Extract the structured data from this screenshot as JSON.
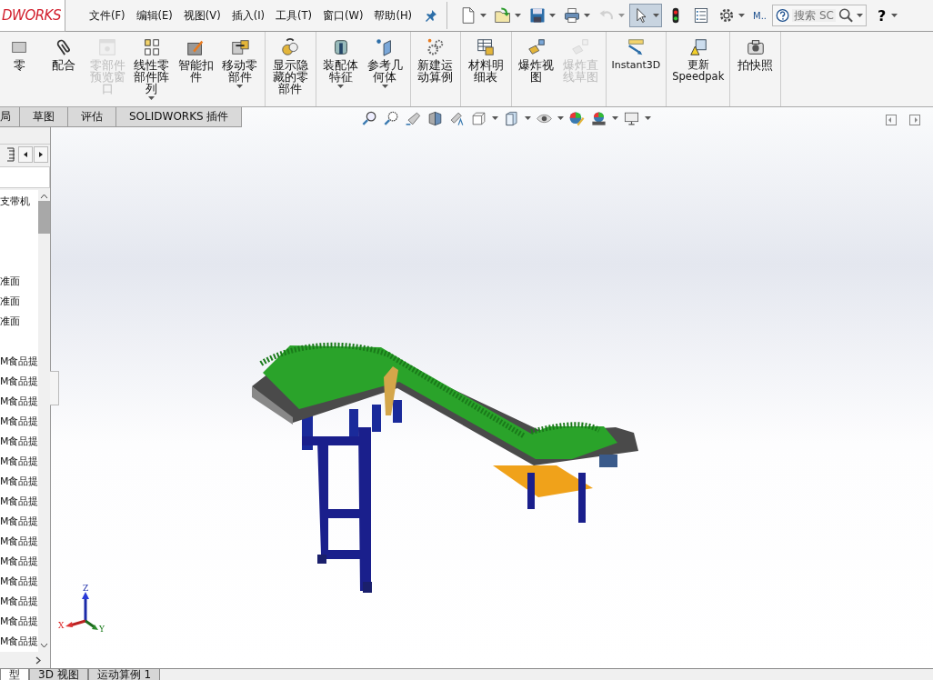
{
  "title_bar": {
    "logo": "DWORKS",
    "menu": [
      "文件(F)",
      "编辑(E)",
      "视图(V)",
      "插入(I)",
      "工具(T)",
      "窗口(W)",
      "帮助(H)"
    ],
    "quick_access": [
      {
        "kind": "new",
        "dropdown": true,
        "disabled": false,
        "selected": false
      },
      {
        "kind": "open",
        "dropdown": true,
        "disabled": false,
        "selected": false
      },
      {
        "kind": "save",
        "dropdown": true,
        "disabled": false,
        "selected": false
      },
      {
        "kind": "print",
        "dropdown": true,
        "disabled": false,
        "selected": false
      },
      {
        "kind": "undo",
        "dropdown": true,
        "disabled": true,
        "selected": false
      },
      {
        "kind": "select",
        "dropdown": true,
        "disabled": false,
        "selected": true
      },
      {
        "kind": "rebuild",
        "dropdown": false,
        "disabled": false,
        "selected": false
      },
      {
        "kind": "properties",
        "dropdown": false,
        "disabled": false,
        "selected": false
      },
      {
        "kind": "options",
        "dropdown": true,
        "disabled": false,
        "selected": false
      }
    ],
    "user": "M..",
    "search": {
      "placeholder": "搜索 SC"
    },
    "help": "?"
  },
  "ribbon": {
    "groups": [
      {
        "items": [
          {
            "kind": "part",
            "label": "零",
            "disabled": false,
            "dropdown": false
          },
          {
            "kind": "mate",
            "label": "配合",
            "disabled": false,
            "dropdown": false
          },
          {
            "kind": "preview",
            "label": "零部件预览窗口",
            "disabled": true,
            "dropdown": false
          },
          {
            "kind": "pattern",
            "label": "线性零部件阵列",
            "disabled": false,
            "dropdown": true
          },
          {
            "kind": "fastener",
            "label": "智能扣件",
            "disabled": false,
            "dropdown": false
          },
          {
            "kind": "move",
            "label": "移动零部件",
            "disabled": false,
            "dropdown": true
          }
        ]
      },
      {
        "items": [
          {
            "kind": "show-hidden",
            "label": "显示隐藏的零部件",
            "disabled": false,
            "dropdown": false
          }
        ]
      },
      {
        "items": [
          {
            "kind": "asm-feature",
            "label": "装配体特征",
            "disabled": false,
            "dropdown": true
          },
          {
            "kind": "ref-geometry",
            "label": "参考几何体",
            "disabled": false,
            "dropdown": true
          }
        ]
      },
      {
        "items": [
          {
            "kind": "motion",
            "label": "新建运动算例",
            "disabled": false,
            "dropdown": false
          }
        ]
      },
      {
        "items": [
          {
            "kind": "bom",
            "label": "材料明细表",
            "disabled": false,
            "dropdown": false
          }
        ]
      },
      {
        "items": [
          {
            "kind": "explode",
            "label": "爆炸视图",
            "disabled": false,
            "dropdown": false
          },
          {
            "kind": "explode-line",
            "label": "爆炸直线草图",
            "disabled": true,
            "dropdown": false
          }
        ]
      },
      {
        "items": [
          {
            "kind": "instant3d",
            "label": "Instant3D",
            "disabled": false,
            "dropdown": false
          }
        ]
      },
      {
        "items": [
          {
            "kind": "speedpak",
            "label": "更新 Speedpak",
            "disabled": false,
            "dropdown": false
          }
        ]
      },
      {
        "items": [
          {
            "kind": "snapshot",
            "label": "拍快照",
            "disabled": false,
            "dropdown": false
          }
        ]
      }
    ]
  },
  "tabs": [
    {
      "label": "局",
      "selected": false
    },
    {
      "label": "草图",
      "selected": false
    },
    {
      "label": "评估",
      "selected": false
    },
    {
      "label": "SOLIDWORKS 插件",
      "selected": false
    }
  ],
  "view_toolbar": [
    {
      "kind": "zoom-fit",
      "dropdown": false
    },
    {
      "kind": "zoom-area",
      "dropdown": false
    },
    {
      "kind": "previous-view",
      "dropdown": false
    },
    {
      "kind": "section",
      "dropdown": false
    },
    {
      "kind": "annotation",
      "dropdown": false
    },
    {
      "kind": "orientation",
      "dropdown": true
    },
    {
      "kind": "display-style",
      "dropdown": true
    },
    {
      "kind": "hide-show",
      "dropdown": true
    },
    {
      "kind": "appearance",
      "dropdown": false
    },
    {
      "kind": "scene",
      "dropdown": true
    },
    {
      "kind": "monitor",
      "dropdown": true
    }
  ],
  "feature_tree": {
    "items": [
      "支带机",
      "准面",
      "准面",
      "准面",
      "M食品提",
      "M食品提",
      "M食品提",
      "M食品提",
      "M食品提",
      "M食品提",
      "M食品提",
      "M食品提",
      "M食品提",
      "M食品提",
      "M食品提",
      "M食品提",
      "M食品提",
      "M食品提",
      "M食品提"
    ]
  },
  "viewport": {
    "triad": {
      "x": "X",
      "y": "Y",
      "z": "Z"
    }
  },
  "bottom_tabs": [
    {
      "label": "型",
      "selected": true
    },
    {
      "label": "3D 视图",
      "selected": false
    },
    {
      "label": "运动算例 1",
      "selected": false
    }
  ]
}
